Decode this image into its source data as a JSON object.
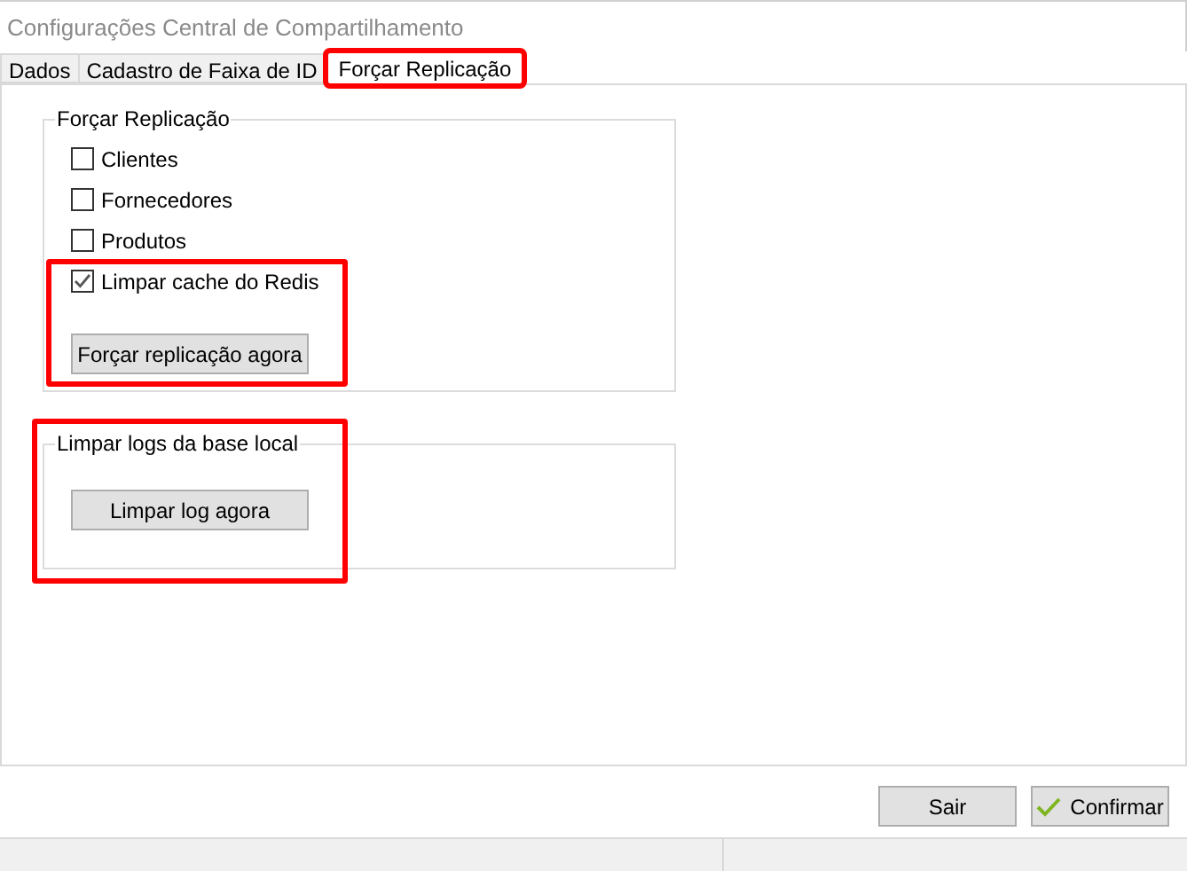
{
  "window": {
    "title": "Configurações Central de Compartilhamento"
  },
  "tabs": [
    {
      "label": "Dados",
      "selected": false,
      "highlighted": false
    },
    {
      "label": "Cadastro de Faixa de ID",
      "selected": false,
      "highlighted": false
    },
    {
      "label": "Forçar Replicação",
      "selected": true,
      "highlighted": true
    }
  ],
  "groups": [
    {
      "title": "Forçar Replicação",
      "highlighted": true,
      "options": [
        {
          "label": "Clientes",
          "checked": false
        },
        {
          "label": "Fornecedores",
          "checked": false
        },
        {
          "label": "Produtos",
          "checked": false
        },
        {
          "label": "Limpar cache do Redis",
          "checked": true
        }
      ],
      "button": "Forçar replicação agora"
    },
    {
      "title": "Limpar logs da base local",
      "highlighted": true,
      "button": "Limpar log agora"
    }
  ],
  "buttons": [
    {
      "label": "Sair",
      "kind": "plain"
    },
    {
      "label": "Confirmar",
      "kind": "confirm"
    }
  ]
}
